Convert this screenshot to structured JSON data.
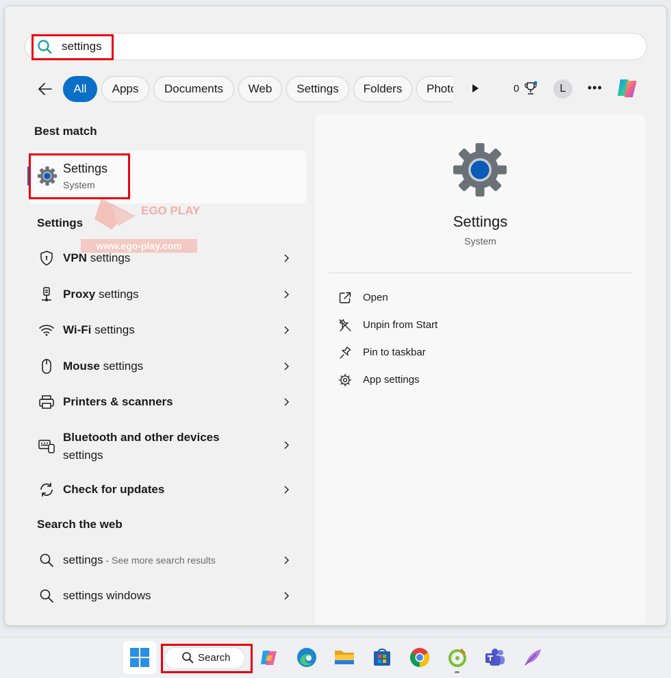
{
  "search": {
    "query": "settings"
  },
  "filters": {
    "tabs": [
      {
        "label": "All",
        "active": true
      },
      {
        "label": "Apps"
      },
      {
        "label": "Documents"
      },
      {
        "label": "Web"
      },
      {
        "label": "Settings"
      },
      {
        "label": "Folders"
      },
      {
        "label": "Photos"
      }
    ],
    "points": "0",
    "avatar_initial": "L"
  },
  "best_match": {
    "heading": "Best match",
    "title": "Settings",
    "subtitle": "System"
  },
  "watermark": {
    "brand": "EGO PLAY",
    "url": "www.ego-play.com"
  },
  "settings_section": {
    "heading": "Settings",
    "items": [
      {
        "bold": "VPN",
        "rest": " settings",
        "icon": "shield-icon"
      },
      {
        "bold": "Proxy",
        "rest": " settings",
        "icon": "proxy-icon"
      },
      {
        "bold": "Wi-Fi",
        "rest": " settings",
        "icon": "wifi-icon"
      },
      {
        "bold": "Mouse",
        "rest": " settings",
        "icon": "mouse-icon"
      },
      {
        "bold": "Printers & scanners",
        "rest": "",
        "icon": "printer-icon"
      },
      {
        "bold": "Bluetooth and other devices",
        "rest": "settings",
        "icon": "devices-icon"
      },
      {
        "bold": "Check for updates",
        "rest": "",
        "icon": "update-icon"
      }
    ]
  },
  "web_section": {
    "heading": "Search the web",
    "items": [
      {
        "bold": "settings",
        "rest": " - ",
        "muted": "See more search results"
      },
      {
        "bold": "settings windows",
        "rest": "",
        "muted": ""
      }
    ]
  },
  "detail": {
    "title": "Settings",
    "subtitle": "System",
    "actions": [
      {
        "label": "Open",
        "icon": "open-external-icon"
      },
      {
        "label": "Unpin from Start",
        "icon": "unpin-icon"
      },
      {
        "label": "Pin to taskbar",
        "icon": "pin-icon"
      },
      {
        "label": "App settings",
        "icon": "gear-icon"
      }
    ]
  },
  "taskbar": {
    "search_label": "Search",
    "apps": [
      "copilot",
      "edge",
      "file-explorer",
      "microsoft-store",
      "chrome",
      "greenshot",
      "teams",
      "feather-app"
    ]
  },
  "colors": {
    "accent": "#0a6fc9",
    "highlight": "#e8000b"
  }
}
